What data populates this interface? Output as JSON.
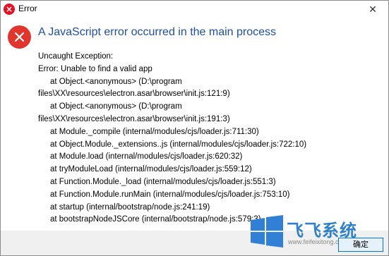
{
  "window": {
    "title": "Error",
    "close_glyph": "✕"
  },
  "icons": {
    "title_icon": "error-icon",
    "big_icon": "error-icon",
    "close_icon": "close-icon"
  },
  "dialog": {
    "heading": "A JavaScript error occurred in the main process",
    "lines": [
      {
        "text": "Uncaught Exception:",
        "indent": false
      },
      {
        "text": "Error: Unable to find a valid app",
        "indent": false
      },
      {
        "text": "at Object.<anonymous> (D:\\program",
        "indent": true
      },
      {
        "text": "files\\XX\\resources\\electron.asar\\browser\\init.js:121:9)",
        "indent": false
      },
      {
        "text": "at Object.<anonymous> (D:\\program",
        "indent": true
      },
      {
        "text": "files\\XX\\resources\\electron.asar\\browser\\init.js:191:3)",
        "indent": false
      },
      {
        "text": "at Module._compile (internal/modules/cjs/loader.js:711:30)",
        "indent": true
      },
      {
        "text": "at Object.Module._extensions..js (internal/modules/cjs/loader.js:722:10)",
        "indent": true
      },
      {
        "text": "at Module.load (internal/modules/cjs/loader.js:620:32)",
        "indent": true
      },
      {
        "text": "at tryModuleLoad (internal/modules/cjs/loader.js:559:12)",
        "indent": true
      },
      {
        "text": "at Function.Module._load (internal/modules/cjs/loader.js:551:3)",
        "indent": true
      },
      {
        "text": "at Function.Module.runMain (internal/modules/cjs/loader.js:753:10)",
        "indent": true
      },
      {
        "text": "at startup (internal/bootstrap/node.js:241:19)",
        "indent": true
      },
      {
        "text": "at bootstrapNodeJSCore (internal/bootstrap/node.js:579:3)",
        "indent": true
      }
    ],
    "ok_label": "确定"
  },
  "watermark": {
    "text": "飞飞系统",
    "url": "www.feifeixitong.com"
  },
  "colors": {
    "error_red": "#e2352d",
    "heading_blue": "#1f4ea8",
    "button_border": "#0078d7",
    "watermark_blue": "#1a74c8"
  }
}
